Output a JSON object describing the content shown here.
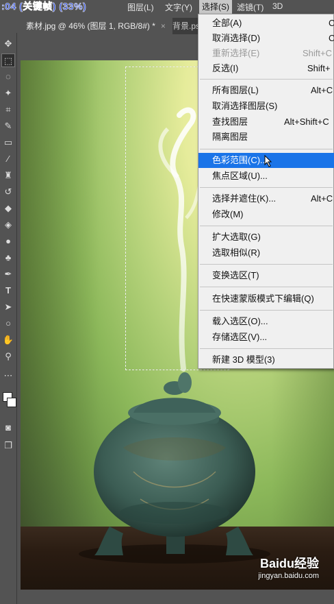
{
  "overlay": {
    "text": ":04 (关键帧) (33%)"
  },
  "menubar": {
    "items": [
      "图层(L)",
      "文字(Y)",
      "选择(S)",
      "滤镜(T)",
      "3D"
    ]
  },
  "tabs": [
    {
      "label": "素材.jpg @ 46% (图层 1, RGB/8#) *",
      "close": "×"
    },
    {
      "label": "背景.ps"
    }
  ],
  "tools": [
    "move-icon",
    "marquee-icon",
    "lasso-icon",
    "magic-wand-icon",
    "crop-icon",
    "eyedropper-icon",
    "healing-brush-icon",
    "brush-icon",
    "clone-stamp-icon",
    "history-brush-icon",
    "eraser-icon",
    "paint-bucket-icon",
    "blur-icon",
    "dodge-icon",
    "pen-icon",
    "type-icon",
    "path-selection-icon",
    "ellipse-icon",
    "hand-icon",
    "zoom-icon",
    "more-tools-icon",
    "color-swatches-icon",
    "quick-mask-icon",
    "screen-mode-icon"
  ],
  "select_menu": {
    "items": [
      {
        "label": "全部(A)",
        "shortcut": "C",
        "state": "normal"
      },
      {
        "label": "取消选择(D)",
        "shortcut": "C",
        "state": "normal"
      },
      {
        "label": "重新选择(E)",
        "shortcut": "Shift+C",
        "state": "disabled"
      },
      {
        "label": "反选(I)",
        "shortcut": "Shift+",
        "state": "normal"
      },
      {
        "label": "所有图层(L)",
        "shortcut": "Alt+C",
        "state": "normal"
      },
      {
        "label": "取消选择图层(S)",
        "shortcut": "",
        "state": "normal"
      },
      {
        "label": "查找图层",
        "shortcut": "Alt+Shift+C",
        "state": "normal"
      },
      {
        "label": "隔离图层",
        "shortcut": "",
        "state": "normal"
      },
      {
        "label": "色彩范围(C)...",
        "shortcut": "",
        "state": "highlighted"
      },
      {
        "label": "焦点区域(U)...",
        "shortcut": "",
        "state": "normal"
      },
      {
        "label": "选择并遮住(K)...",
        "shortcut": "Alt+C",
        "state": "normal"
      },
      {
        "label": "修改(M)",
        "shortcut": "",
        "state": "normal"
      },
      {
        "label": "扩大选取(G)",
        "shortcut": "",
        "state": "normal"
      },
      {
        "label": "选取相似(R)",
        "shortcut": "",
        "state": "normal"
      },
      {
        "label": "变换选区(T)",
        "shortcut": "",
        "state": "normal"
      },
      {
        "label": "在快速蒙版模式下编辑(Q)",
        "shortcut": "",
        "state": "normal"
      },
      {
        "label": "载入选区(O)...",
        "shortcut": "",
        "state": "normal"
      },
      {
        "label": "存储选区(V)...",
        "shortcut": "",
        "state": "normal"
      },
      {
        "label": "新建 3D 模型(3)",
        "shortcut": "",
        "state": "normal"
      }
    ]
  },
  "watermark": {
    "brand": "Baidu经验",
    "url": "jingyan.baidu.com"
  },
  "colors": {
    "highlight": "#1a74e8",
    "menu_bg": "#f0f0f0",
    "ui_bg": "#535353"
  }
}
